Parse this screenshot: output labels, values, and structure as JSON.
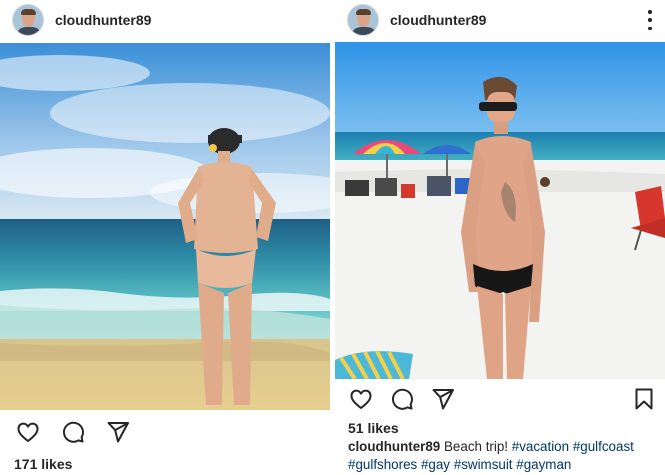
{
  "posts": [
    {
      "username": "cloudhunter89",
      "likes": "171 likes",
      "photo": "man-on-beach-facing-ocean",
      "icons": [
        "heart-icon",
        "comment-icon",
        "share-icon"
      ]
    },
    {
      "username": "cloudhunter89",
      "likes": "51 likes",
      "photo": "man-in-swimsuit-on-beach",
      "caption": {
        "username": "cloudhunter89",
        "text": "Beach trip!",
        "hashtags": [
          "#vacation",
          "#gulfcoast",
          "#gulfshores",
          "#gay",
          "#swimsuit",
          "#gayman"
        ]
      },
      "icons": [
        "heart-icon",
        "comment-icon",
        "share-icon",
        "bookmark-icon",
        "more-options-icon"
      ]
    }
  ],
  "colors": {
    "text": "#262626",
    "hashtag": "#00376b",
    "sky": "#3f9ee6",
    "sea": "#2f9bb0",
    "sand": "#e9d29a"
  }
}
